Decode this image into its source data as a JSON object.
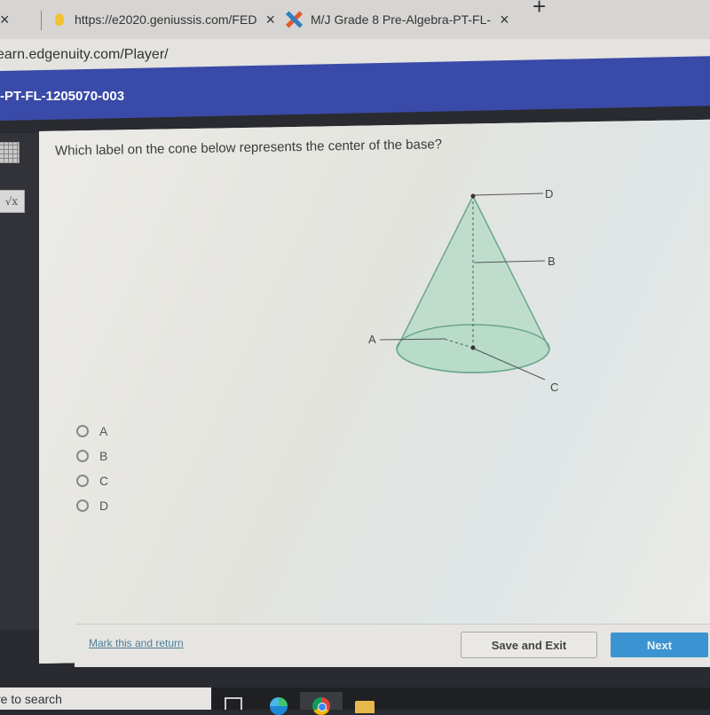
{
  "browser": {
    "tabs": [
      {
        "label": "",
        "close_icon": "×"
      },
      {
        "label": "https://e2020.geniussis.com/FED",
        "favicon": "lightbulb-icon",
        "close_icon": "×"
      },
      {
        "label": "M/J Grade 8 Pre-Algebra-PT-FL-",
        "favicon": "edgenuity-x-logo",
        "close_icon": "×"
      }
    ],
    "new_tab_icon": "+",
    "address_url": "earn.edgenuity.com/Player/"
  },
  "app": {
    "course_title": "-PT-FL-1205070-003",
    "tools": [
      {
        "name": "calculator-icon"
      },
      {
        "name": "formula-sqrt-icon",
        "glyph": "√x"
      }
    ]
  },
  "question": {
    "prompt": "Which label on the cone below represents the center of the base?",
    "figure": {
      "shape": "cone",
      "fill_color": "#b9dcc9",
      "stroke_color": "#6aa58c",
      "labels": [
        {
          "id": "D",
          "points_to": "apex"
        },
        {
          "id": "B",
          "points_to": "height (altitude) segment"
        },
        {
          "id": "A",
          "points_to": "radius segment"
        },
        {
          "id": "C",
          "points_to": "center of base"
        }
      ]
    },
    "options": [
      {
        "label": "A",
        "selected": false
      },
      {
        "label": "B",
        "selected": false
      },
      {
        "label": "C",
        "selected": false
      },
      {
        "label": "D",
        "selected": false
      }
    ]
  },
  "footer": {
    "mark_link": "Mark this and return",
    "save_button": "Save and Exit",
    "next_button": "Next",
    "next_color": "#3b94d1"
  },
  "taskbar": {
    "search_placeholder": "re to search",
    "apps": [
      "task-view-icon",
      "edge-icon",
      "chrome-icon",
      "file-explorer-icon"
    ]
  }
}
